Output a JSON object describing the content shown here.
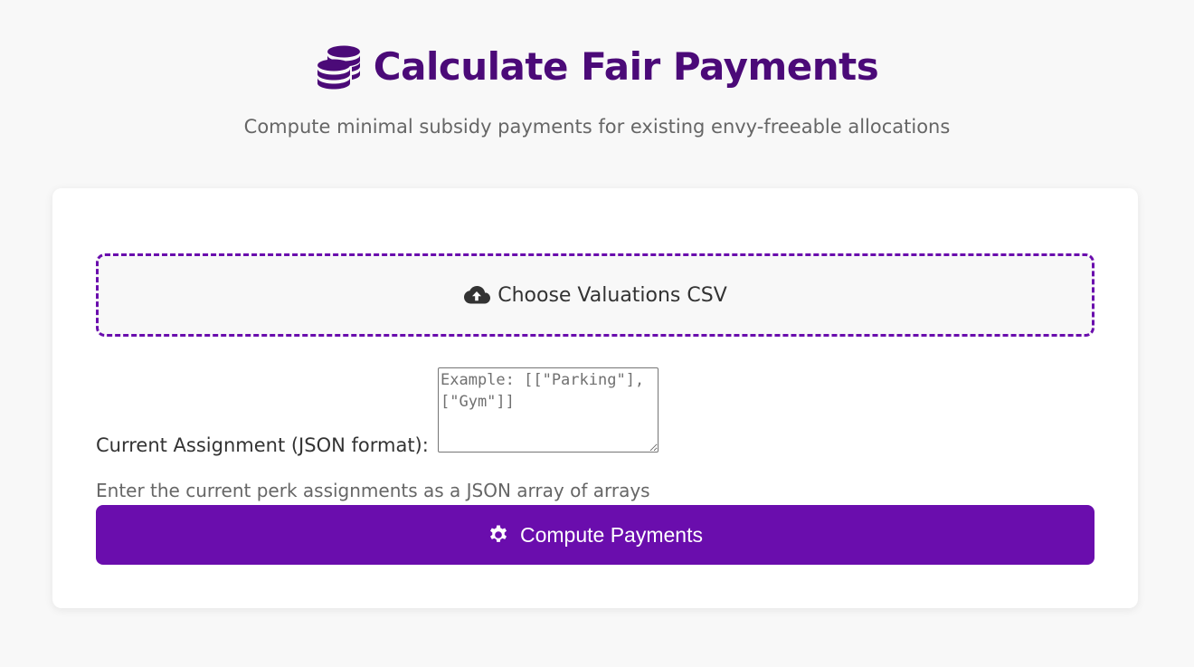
{
  "header": {
    "title": "Calculate Fair Payments",
    "subtitle": "Compute minimal subsidy payments for existing envy-freeable allocations",
    "icon": "coins-icon"
  },
  "upload": {
    "label": "Choose Valuations CSV",
    "icon": "cloud-upload-icon"
  },
  "assignment": {
    "label": "Current Assignment (JSON format):",
    "placeholder": "Example: [[\"Parking\"], [\"Gym\"]]",
    "value": "",
    "help": "Enter the current perk assignments as a JSON array of arrays"
  },
  "compute": {
    "label": "Compute Payments",
    "icon": "gear-icon"
  },
  "colors": {
    "accent": "#6a0dad",
    "title": "#4b0a78",
    "background": "#f8f8f8"
  }
}
